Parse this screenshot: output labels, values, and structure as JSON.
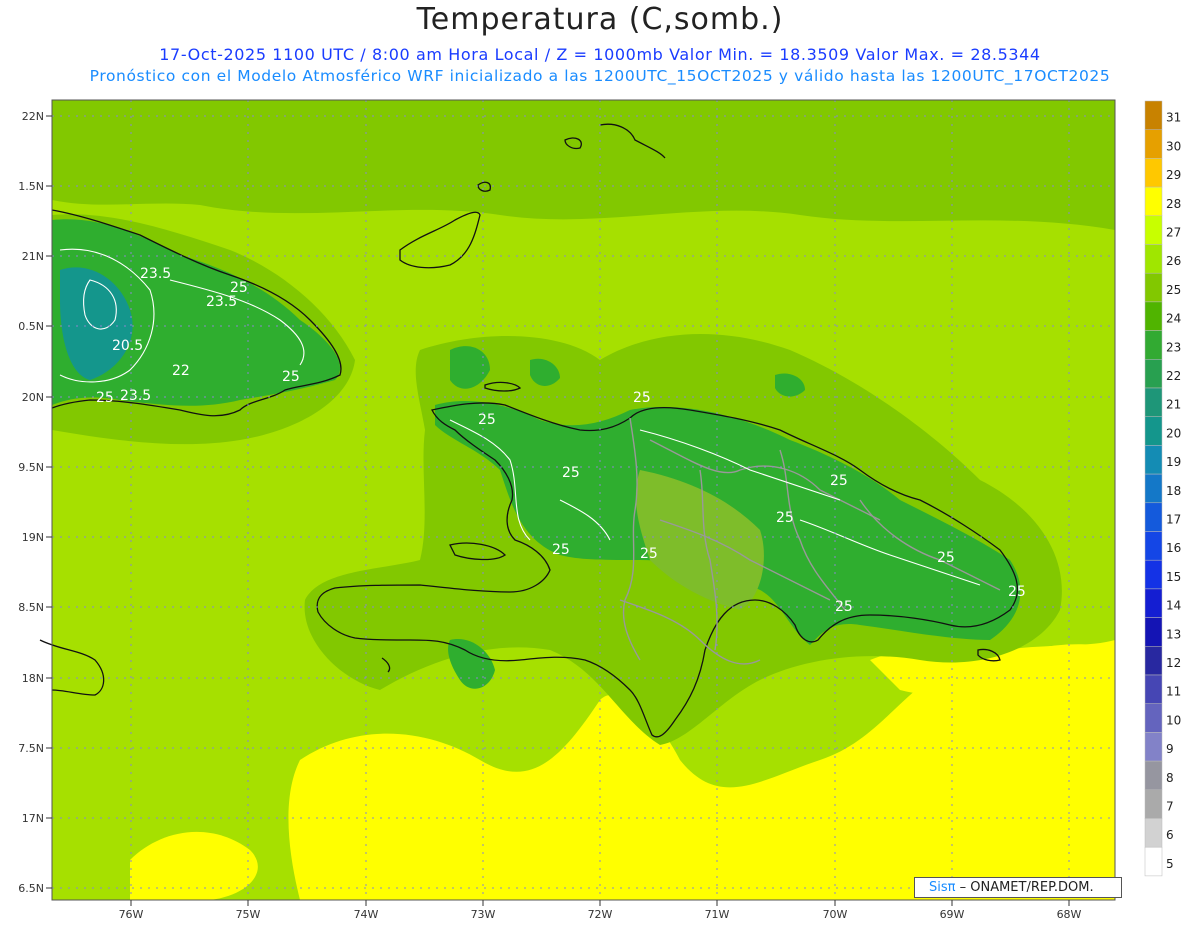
{
  "title": "Temperatura (C,somb.)",
  "subtitle_line1": "17-Oct-2025  1100 UTC / 8:00 am Hora Local / Z = 1000mb   Valor Min. = 18.3509  Valor Max. = 28.5344",
  "subtitle_line2": "Pronóstico con el Modelo Atmosférico WRF inicializado a las 1200UTC_15OCT2025 y válido hasta las  1200UTC_17OCT2025",
  "axes": {
    "lat_labels": [
      "22N",
      "1.5N",
      "21N",
      "0.5N",
      "20N",
      "9.5N",
      "19N",
      "8.5N",
      "18N",
      "7.5N",
      "17N",
      "6.5N"
    ],
    "lon_labels": [
      "76W",
      "75W",
      "74W",
      "73W",
      "72W",
      "71W",
      "70W",
      "69W",
      "68W"
    ]
  },
  "colorbar": {
    "labels": [
      "31",
      "30",
      "29",
      "28",
      "27",
      "26",
      "25",
      "24",
      "23",
      "22",
      "21",
      "20",
      "19",
      "18",
      "17",
      "16",
      "15",
      "14",
      "13",
      "12",
      "11",
      "10",
      "9",
      "8",
      "7",
      "6",
      "5"
    ],
    "colors": [
      "#c88200",
      "#e6a000",
      "#ffc800",
      "#ffff00",
      "#c8ff00",
      "#a0e600",
      "#82c800",
      "#50b400",
      "#32aa32",
      "#28a050",
      "#1e9678",
      "#14968c",
      "#148cb4",
      "#1478c8",
      "#145adc",
      "#1446e6",
      "#1432e6",
      "#141ed2",
      "#1414b4",
      "#2828a0",
      "#4646b4",
      "#6464be",
      "#8282c8",
      "#9696a0",
      "#aaaaaa",
      "#d2d2d2",
      "#ffffff"
    ]
  },
  "contour_labels": [
    "23.5",
    "25",
    "23.5",
    "20.5",
    "22",
    "25",
    "25",
    "23.5",
    "25",
    "25",
    "25",
    "25",
    "25",
    "25",
    "25",
    "25",
    "25",
    "25"
  ],
  "credit": {
    "brand": "Sisπ",
    "text": "– ONAMET/REP.DOM."
  },
  "legend_colors": {
    "ocean_base": "#a6e000",
    "ocean_yellow": "#ffff00",
    "land_green": "#2fae2f",
    "land_olive": "#7ebd2a",
    "grid": "#8888cc"
  }
}
